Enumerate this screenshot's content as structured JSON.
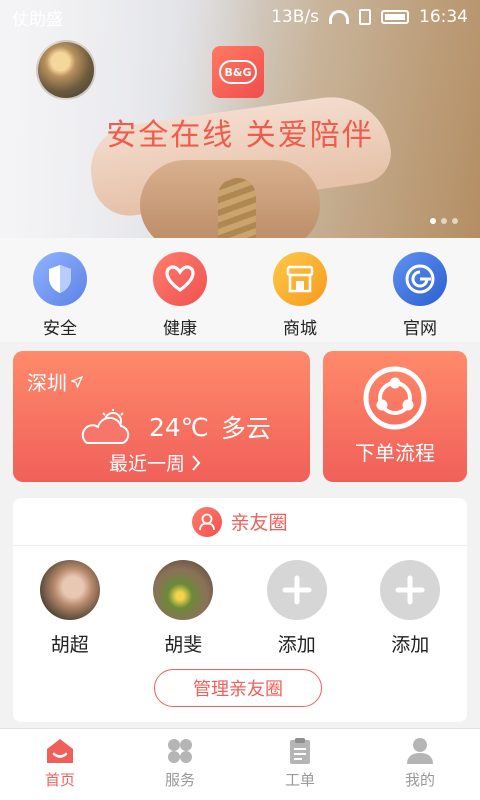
{
  "status_bar": {
    "carrier": "仗助盛",
    "net_speed": "13B/s",
    "time": "16:34"
  },
  "banner": {
    "logo_text": "B&G",
    "slogan": "安全在线  关爱陪伴",
    "slides": 3,
    "active_slide": 0
  },
  "quick_links": [
    {
      "label": "安全",
      "icon": "shield-icon",
      "color": "#5d82e6"
    },
    {
      "label": "健康",
      "icon": "heart-icon",
      "color": "#f05151"
    },
    {
      "label": "商城",
      "icon": "shop-icon",
      "color": "#f59a1d"
    },
    {
      "label": "官网",
      "icon": "globe-g-icon",
      "color": "#2c5fcf"
    }
  ],
  "weather": {
    "city": "深圳",
    "temp": "24℃",
    "condition": "多云",
    "week_link": "最近一周"
  },
  "order": {
    "label": "下单流程"
  },
  "friends": {
    "title": "亲友圈",
    "members": [
      {
        "name": "胡超",
        "type": "avatar"
      },
      {
        "name": "胡斐",
        "type": "avatar"
      },
      {
        "name": "添加",
        "type": "add"
      },
      {
        "name": "添加",
        "type": "add"
      }
    ],
    "manage_label": "管理亲友圈"
  },
  "tabbar": [
    {
      "label": "首页",
      "icon": "home-icon",
      "active": true
    },
    {
      "label": "服务",
      "icon": "service-icon",
      "active": false
    },
    {
      "label": "工单",
      "icon": "clipboard-icon",
      "active": false
    },
    {
      "label": "我的",
      "icon": "user-icon",
      "active": false
    }
  ],
  "colors": {
    "accent": "#f0605a",
    "inactive": "#999999"
  }
}
